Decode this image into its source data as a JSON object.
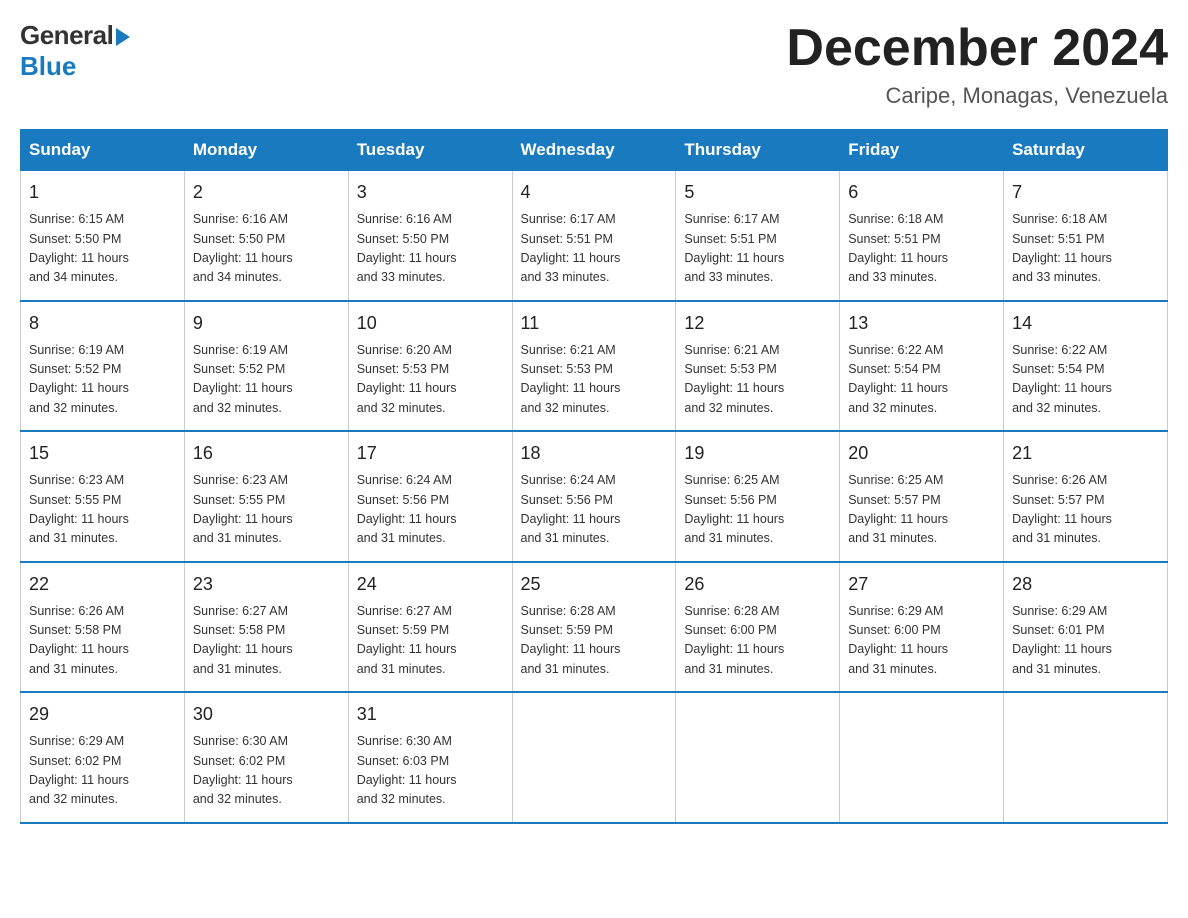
{
  "logo": {
    "general": "General",
    "blue": "Blue"
  },
  "title": {
    "month_year": "December 2024",
    "location": "Caripe, Monagas, Venezuela"
  },
  "days_of_week": [
    "Sunday",
    "Monday",
    "Tuesday",
    "Wednesday",
    "Thursday",
    "Friday",
    "Saturday"
  ],
  "weeks": [
    [
      {
        "day": "1",
        "sunrise": "6:15 AM",
        "sunset": "5:50 PM",
        "daylight": "11 hours and 34 minutes."
      },
      {
        "day": "2",
        "sunrise": "6:16 AM",
        "sunset": "5:50 PM",
        "daylight": "11 hours and 34 minutes."
      },
      {
        "day": "3",
        "sunrise": "6:16 AM",
        "sunset": "5:50 PM",
        "daylight": "11 hours and 33 minutes."
      },
      {
        "day": "4",
        "sunrise": "6:17 AM",
        "sunset": "5:51 PM",
        "daylight": "11 hours and 33 minutes."
      },
      {
        "day": "5",
        "sunrise": "6:17 AM",
        "sunset": "5:51 PM",
        "daylight": "11 hours and 33 minutes."
      },
      {
        "day": "6",
        "sunrise": "6:18 AM",
        "sunset": "5:51 PM",
        "daylight": "11 hours and 33 minutes."
      },
      {
        "day": "7",
        "sunrise": "6:18 AM",
        "sunset": "5:51 PM",
        "daylight": "11 hours and 33 minutes."
      }
    ],
    [
      {
        "day": "8",
        "sunrise": "6:19 AM",
        "sunset": "5:52 PM",
        "daylight": "11 hours and 32 minutes."
      },
      {
        "day": "9",
        "sunrise": "6:19 AM",
        "sunset": "5:52 PM",
        "daylight": "11 hours and 32 minutes."
      },
      {
        "day": "10",
        "sunrise": "6:20 AM",
        "sunset": "5:53 PM",
        "daylight": "11 hours and 32 minutes."
      },
      {
        "day": "11",
        "sunrise": "6:21 AM",
        "sunset": "5:53 PM",
        "daylight": "11 hours and 32 minutes."
      },
      {
        "day": "12",
        "sunrise": "6:21 AM",
        "sunset": "5:53 PM",
        "daylight": "11 hours and 32 minutes."
      },
      {
        "day": "13",
        "sunrise": "6:22 AM",
        "sunset": "5:54 PM",
        "daylight": "11 hours and 32 minutes."
      },
      {
        "day": "14",
        "sunrise": "6:22 AM",
        "sunset": "5:54 PM",
        "daylight": "11 hours and 32 minutes."
      }
    ],
    [
      {
        "day": "15",
        "sunrise": "6:23 AM",
        "sunset": "5:55 PM",
        "daylight": "11 hours and 31 minutes."
      },
      {
        "day": "16",
        "sunrise": "6:23 AM",
        "sunset": "5:55 PM",
        "daylight": "11 hours and 31 minutes."
      },
      {
        "day": "17",
        "sunrise": "6:24 AM",
        "sunset": "5:56 PM",
        "daylight": "11 hours and 31 minutes."
      },
      {
        "day": "18",
        "sunrise": "6:24 AM",
        "sunset": "5:56 PM",
        "daylight": "11 hours and 31 minutes."
      },
      {
        "day": "19",
        "sunrise": "6:25 AM",
        "sunset": "5:56 PM",
        "daylight": "11 hours and 31 minutes."
      },
      {
        "day": "20",
        "sunrise": "6:25 AM",
        "sunset": "5:57 PM",
        "daylight": "11 hours and 31 minutes."
      },
      {
        "day": "21",
        "sunrise": "6:26 AM",
        "sunset": "5:57 PM",
        "daylight": "11 hours and 31 minutes."
      }
    ],
    [
      {
        "day": "22",
        "sunrise": "6:26 AM",
        "sunset": "5:58 PM",
        "daylight": "11 hours and 31 minutes."
      },
      {
        "day": "23",
        "sunrise": "6:27 AM",
        "sunset": "5:58 PM",
        "daylight": "11 hours and 31 minutes."
      },
      {
        "day": "24",
        "sunrise": "6:27 AM",
        "sunset": "5:59 PM",
        "daylight": "11 hours and 31 minutes."
      },
      {
        "day": "25",
        "sunrise": "6:28 AM",
        "sunset": "5:59 PM",
        "daylight": "11 hours and 31 minutes."
      },
      {
        "day": "26",
        "sunrise": "6:28 AM",
        "sunset": "6:00 PM",
        "daylight": "11 hours and 31 minutes."
      },
      {
        "day": "27",
        "sunrise": "6:29 AM",
        "sunset": "6:00 PM",
        "daylight": "11 hours and 31 minutes."
      },
      {
        "day": "28",
        "sunrise": "6:29 AM",
        "sunset": "6:01 PM",
        "daylight": "11 hours and 31 minutes."
      }
    ],
    [
      {
        "day": "29",
        "sunrise": "6:29 AM",
        "sunset": "6:02 PM",
        "daylight": "11 hours and 32 minutes."
      },
      {
        "day": "30",
        "sunrise": "6:30 AM",
        "sunset": "6:02 PM",
        "daylight": "11 hours and 32 minutes."
      },
      {
        "day": "31",
        "sunrise": "6:30 AM",
        "sunset": "6:03 PM",
        "daylight": "11 hours and 32 minutes."
      },
      null,
      null,
      null,
      null
    ]
  ],
  "labels": {
    "sunrise": "Sunrise:",
    "sunset": "Sunset:",
    "daylight": "Daylight:"
  }
}
